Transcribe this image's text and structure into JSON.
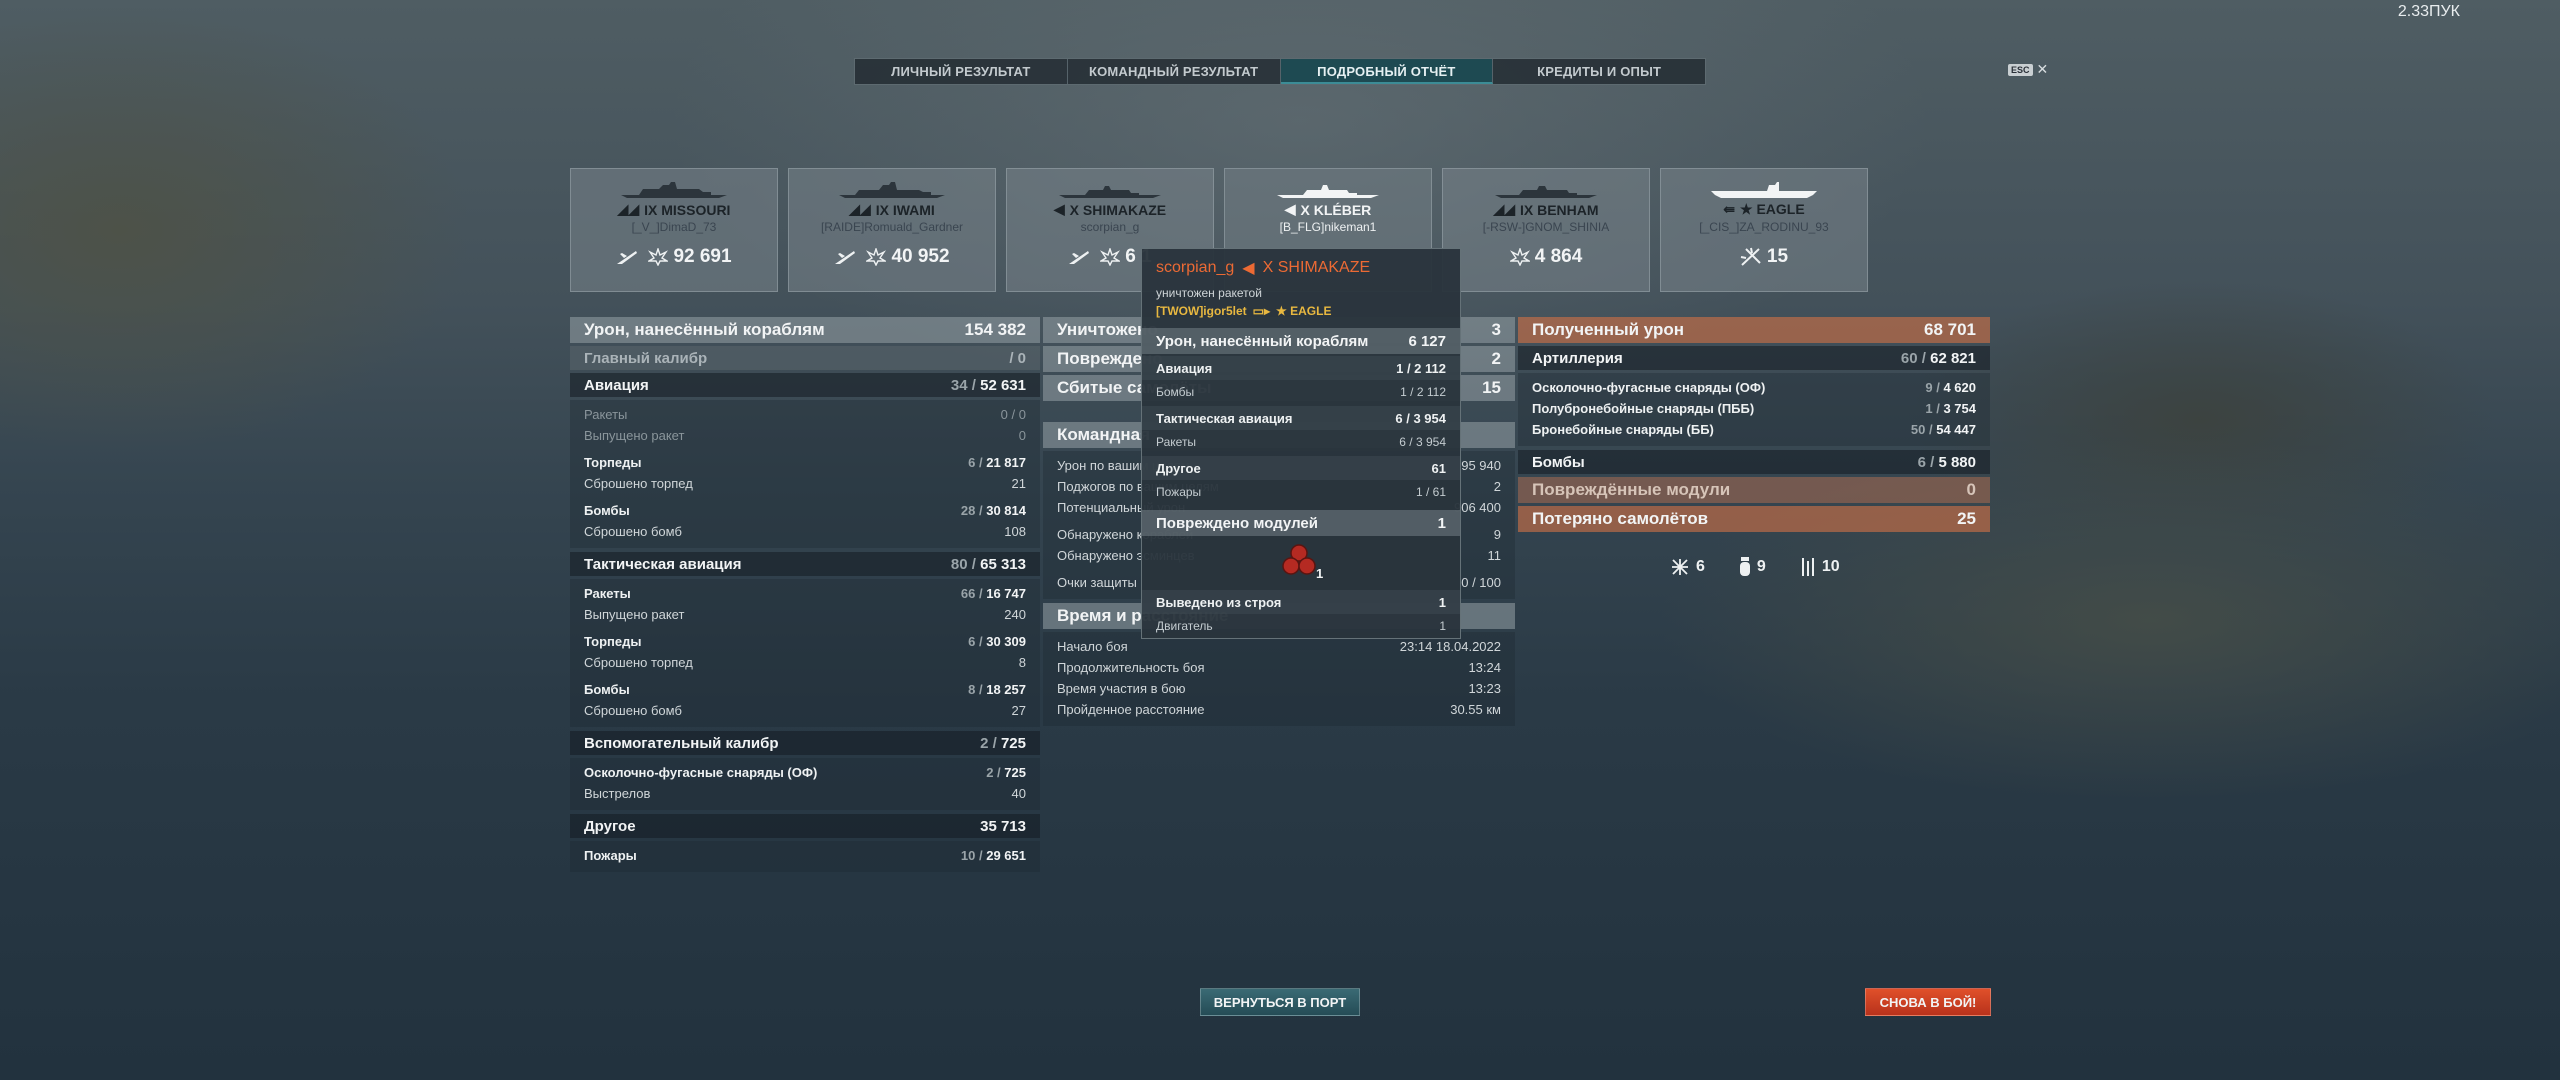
{
  "version": "2.33ПУК",
  "esc": {
    "key": "ESC",
    "close": "✕"
  },
  "tabs": [
    {
      "label": "ЛИЧНЫЙ РЕЗУЛЬТАТ",
      "active": false
    },
    {
      "label": "КОМАНДНЫЙ РЕЗУЛЬТАТ",
      "active": false
    },
    {
      "label": "ПОДРОБНЫЙ ОТЧЁТ",
      "active": true
    },
    {
      "label": "КРЕДИТЫ И ОПЫТ",
      "active": false
    }
  ],
  "ships": [
    {
      "title": "IX MISSOURI",
      "player": "[_V_]DimaD_73",
      "stat_icon": "plane-icon",
      "stat": "92 691"
    },
    {
      "title": "IX IWAMI",
      "player": "[RAIDE]Romuald_Gardner",
      "stat_icon": "plane-icon",
      "stat": "40 952"
    },
    {
      "title": "X SHIMAKAZE",
      "player": "scorpian_g",
      "stat_icon": "plane-icon",
      "stat": "6 1"
    },
    {
      "title": "X KLÉBER",
      "player": "[B_FLG]nikeman1",
      "stat_icon": "",
      "stat": ""
    },
    {
      "title": "IX BENHAM",
      "player": "[-RSW-]GNOM_SHINIA",
      "stat_icon": "",
      "stat": "4 864"
    },
    {
      "title": "★ EAGLE",
      "player": "[_CIS_]ZA_RODINU_93",
      "stat_icon": "aa-icon",
      "stat": "15"
    }
  ],
  "left": {
    "damage": {
      "label": "Урон, нанесённый кораблям",
      "value": "154 382"
    },
    "main_caliber": {
      "label": "Главный калибр",
      "value": "/ 0"
    },
    "aviation": {
      "label": "Авиация",
      "hits": "34 /",
      "value": "52 631"
    },
    "aviation_rows": [
      {
        "label": "Ракеты",
        "hits": "0 /",
        "value": "0",
        "muted": true
      },
      {
        "label": "Выпущено ракет",
        "hits": "",
        "value": "0",
        "muted": true
      },
      {
        "label": "Торпеды",
        "hits": "6 /",
        "value": "21 817",
        "bold": true
      },
      {
        "label": "Сброшено торпед",
        "hits": "",
        "value": "21"
      },
      {
        "label": "Бомбы",
        "hits": "28 /",
        "value": "30 814",
        "bold": true
      },
      {
        "label": "Сброшено бомб",
        "hits": "",
        "value": "108"
      }
    ],
    "tactical": {
      "label": "Тактическая авиация",
      "hits": "80 /",
      "value": "65 313"
    },
    "tactical_rows": [
      {
        "label": "Ракеты",
        "hits": "66 /",
        "value": "16 747",
        "bold": true
      },
      {
        "label": "Выпущено ракет",
        "hits": "",
        "value": "240"
      },
      {
        "label": "Торпеды",
        "hits": "6 /",
        "value": "30 309",
        "bold": true
      },
      {
        "label": "Сброшено торпед",
        "hits": "",
        "value": "8"
      },
      {
        "label": "Бомбы",
        "hits": "8 /",
        "value": "18 257",
        "bold": true
      },
      {
        "label": "Сброшено бомб",
        "hits": "",
        "value": "27"
      }
    ],
    "secondary": {
      "label": "Вспомогательный калибр",
      "hits": "2 /",
      "value": "725"
    },
    "secondary_rows": [
      {
        "label": "Осколочно-фугасные снаряды (ОФ)",
        "hits": "2 /",
        "value": "725",
        "bold": true
      },
      {
        "label": "Выстрелов",
        "hits": "",
        "value": "40"
      }
    ],
    "other": {
      "label": "Другое",
      "value": "35 713"
    },
    "other_rows": [
      {
        "label": "Пожары",
        "hits": "10 /",
        "value": "29 651",
        "bold": true
      }
    ]
  },
  "middle": {
    "destroyed": {
      "label": "Уничтожено",
      "value": "3"
    },
    "damaged": {
      "label": "Повреждено",
      "value": "2"
    },
    "planes": {
      "label": "Сбитые самолёты",
      "value": "15"
    },
    "team": {
      "label": "Командная"
    },
    "team_rows": [
      {
        "label": "Урон по вашим целям",
        "value": "95 940"
      },
      {
        "label": "Поджогов по вашим целям",
        "value": "2"
      },
      {
        "label": "Потенциальный урон",
        "value": "906 400"
      },
      {
        "label": "Обнаружено кораблей",
        "value": "9"
      },
      {
        "label": "Обнаружено эсминцев",
        "value": "11"
      },
      {
        "label": "Очки защиты",
        "value": "0 / 100"
      }
    ],
    "time": {
      "label": "Время и расстояние"
    },
    "time_rows": [
      {
        "label": "Начало боя",
        "value": "23:14   18.04.2022"
      },
      {
        "label": "Продолжительность боя",
        "value": "13:24"
      },
      {
        "label": "Время участия в бою",
        "value": "13:23"
      },
      {
        "label": "Пройденное расстояние",
        "value": "30.55 км"
      }
    ]
  },
  "right": {
    "received": {
      "label": "Полученный урон",
      "value": "68 701"
    },
    "artillery": {
      "label": "Артиллерия",
      "hits": "60 /",
      "value": "62 821"
    },
    "artillery_rows": [
      {
        "label": "Осколочно-фугасные снаряды (ОФ)",
        "hits": "9 /",
        "value": "4 620"
      },
      {
        "label": "Полубронебойные снаряды (ПББ)",
        "hits": "1 /",
        "value": "3 754"
      },
      {
        "label": "Бронебойные снаряды (ББ)",
        "hits": "50 /",
        "value": "54 447"
      }
    ],
    "bombs": {
      "label": "Бомбы",
      "hits": "6 /",
      "value": "5 880"
    },
    "modules": {
      "label": "Повреждённые модули",
      "value": "0"
    },
    "lost_planes": {
      "label": "Потеряно самолётов",
      "value": "25"
    },
    "plane_summary": [
      {
        "icon": "plane-shot-icon",
        "value": "6"
      },
      {
        "icon": "bomb-icon",
        "value": "9"
      },
      {
        "icon": "torpedo-icon",
        "value": "10"
      }
    ]
  },
  "tooltip": {
    "player": "scorpian_g",
    "ship": "X SHIMAKAZE",
    "cause": "уничтожен ракетой",
    "killer": "[TWOW]igor5let",
    "killer_ship": "★ EAGLE",
    "damage": {
      "label": "Урон, нанесённый кораблям",
      "value": "6 127"
    },
    "aviation": {
      "label": "Авиация",
      "value": "1 / 2 112"
    },
    "aviation_bombs": {
      "label": "Бомбы",
      "value": "1 / 2 112"
    },
    "tactical": {
      "label": "Тактическая авиация",
      "value": "6 / 3 954"
    },
    "tactical_rockets": {
      "label": "Ракеты",
      "value": "6 / 3 954"
    },
    "other": {
      "label": "Другое",
      "value": "61"
    },
    "fires": {
      "label": "Пожары",
      "value": "1 / 61"
    },
    "modules": {
      "label": "Повреждено модулей",
      "value": "1"
    },
    "module_count": "1",
    "disabled": {
      "label": "Выведено из строя",
      "value": "1"
    },
    "engine": {
      "label": "Двигатель",
      "value": "1"
    }
  },
  "buttons": {
    "port": "ВЕРНУТЬСЯ В ПОРТ",
    "battle": "СНОВА В БОЙ!"
  }
}
